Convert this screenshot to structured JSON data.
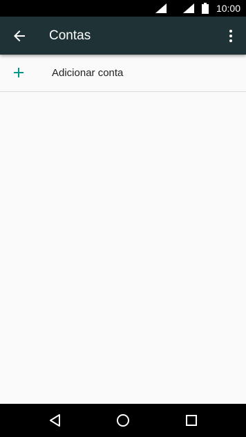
{
  "status_bar": {
    "time": "10:00",
    "icons": [
      "signal-icon",
      "signal-icon",
      "battery-icon"
    ]
  },
  "app_bar": {
    "title": "Contas",
    "back_icon": "arrow-back-icon",
    "menu_icon": "more-vert-icon",
    "background": "#1f3336"
  },
  "accounts": {
    "add_account_label": "Adicionar conta",
    "add_icon": "plus-icon",
    "accent": "#009688"
  },
  "nav_bar": {
    "icons": [
      "nav-back-icon",
      "nav-home-icon",
      "nav-recents-icon"
    ]
  }
}
